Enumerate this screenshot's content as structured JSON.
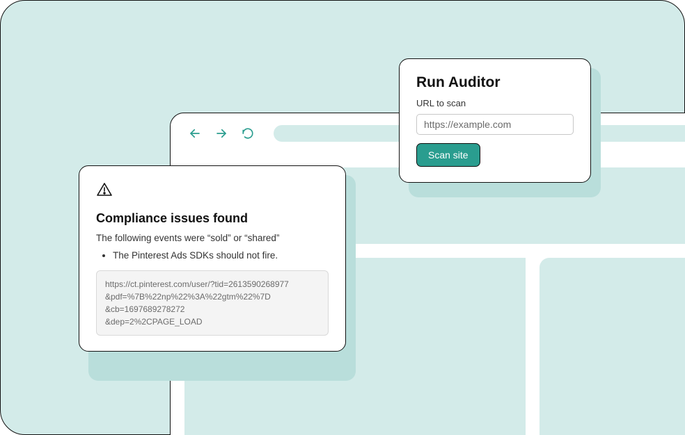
{
  "auditor": {
    "title": "Run Auditor",
    "url_label": "URL to scan",
    "url_value": "https://example.com",
    "scan_button": "Scan site"
  },
  "compliance": {
    "title": "Compliance issues found",
    "subtitle": "The following events were “sold” or “shared”",
    "bullet": "The Pinterest Ads SDKs should not fire.",
    "request_line1": "https://ct.pinterest.com/user/?tid=2613590268977",
    "request_line2": "&pdf=%7B%22np%22%3A%22gtm%22%7D",
    "request_line3": "&cb=1697689278272",
    "request_line4": "&dep=2%2CPAGE_LOAD"
  },
  "colors": {
    "accent": "#2a9d8f",
    "bg": "#d3ebe9"
  }
}
